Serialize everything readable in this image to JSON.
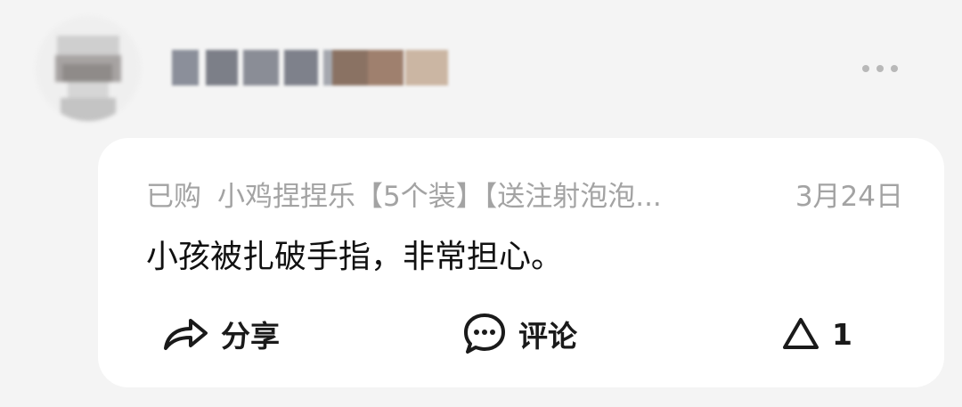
{
  "review": {
    "purchased_label": "已购",
    "product_name": "小鸡捏捏乐【5个装】【送注射泡泡...",
    "date": "3月24日",
    "text": "小孩被扎破手指，非常担心。"
  },
  "actions": {
    "share_label": "分享",
    "comment_label": "评论",
    "like_count": "1"
  },
  "icons": {
    "more": "more-dots-icon",
    "share": "share-arrow-icon",
    "comment": "comment-bubble-icon",
    "like": "triangle-like-icon"
  },
  "colors": {
    "background": "#f4f4f4",
    "card": "#ffffff",
    "meta_text": "#a3a3a3",
    "body_text": "#111111",
    "icon": "#1a1a1a",
    "more_dots": "#b8b8b8"
  }
}
